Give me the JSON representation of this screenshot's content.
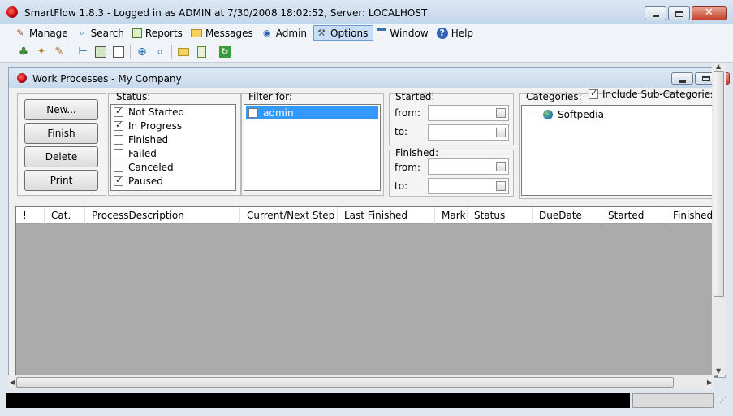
{
  "window": {
    "title": "SmartFlow 1.8.3 - Logged in as ADMIN at 7/30/2008 18:02:52, Server: LOCALHOST"
  },
  "menu": [
    {
      "label": "Manage",
      "icon": "pencil-icon"
    },
    {
      "label": "Search",
      "icon": "magnifier-icon"
    },
    {
      "label": "Reports",
      "icon": "report-icon"
    },
    {
      "label": "Messages",
      "icon": "folder-icon"
    },
    {
      "label": "Admin",
      "icon": "admin-icon"
    },
    {
      "label": "Options",
      "icon": "tools-icon"
    },
    {
      "label": "Window",
      "icon": "window-icon"
    },
    {
      "label": "Help",
      "icon": "help-icon"
    }
  ],
  "child": {
    "title": "Work Processes - My Company",
    "buttons": {
      "new": "New...",
      "finish": "Finish",
      "delete": "Delete",
      "print": "Print"
    },
    "status_label": "Status:",
    "status_items": [
      {
        "label": "Not Started",
        "checked": true
      },
      {
        "label": "In Progress",
        "checked": true
      },
      {
        "label": "Finished",
        "checked": false
      },
      {
        "label": "Failed",
        "checked": false
      },
      {
        "label": "Canceled",
        "checked": false
      },
      {
        "label": "Paused",
        "checked": true
      }
    ],
    "filter_label": "Filter for:",
    "filter_items": [
      {
        "label": "admin",
        "checked": false,
        "selected": true
      }
    ],
    "started_label": "Started:",
    "finished_label": "Finished:",
    "from_label": "from:",
    "to_label": "to:",
    "categories_label": "Categories:",
    "include_sub_label": "Include Sub-Categories",
    "include_sub_checked": true,
    "categories_tree": [
      {
        "label": "Softpedia"
      }
    ],
    "columns": [
      "!",
      "Cat.",
      "ProcessDescription",
      "Current/Next Step",
      "Last Finished",
      "Mark",
      "Status",
      "DueDate",
      "Started",
      "Finished"
    ]
  }
}
